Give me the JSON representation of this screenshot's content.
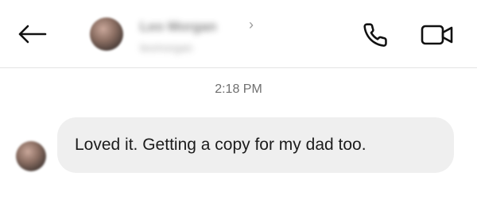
{
  "header": {
    "contact_name": "Leo Morgan",
    "contact_username": "leomorgan",
    "chevron": "›",
    "back_icon": "arrow-left-icon",
    "call_icon": "phone-icon",
    "video_icon": "video-camera-icon"
  },
  "conversation": {
    "timestamp": "2:18 PM",
    "messages": [
      {
        "text": "Loved it. Getting a copy for my dad too.",
        "incoming": true
      }
    ]
  },
  "colors": {
    "bubble_incoming": "#efefef",
    "timestamp_text": "#6f6f6f",
    "divider": "#e3e3e3"
  }
}
